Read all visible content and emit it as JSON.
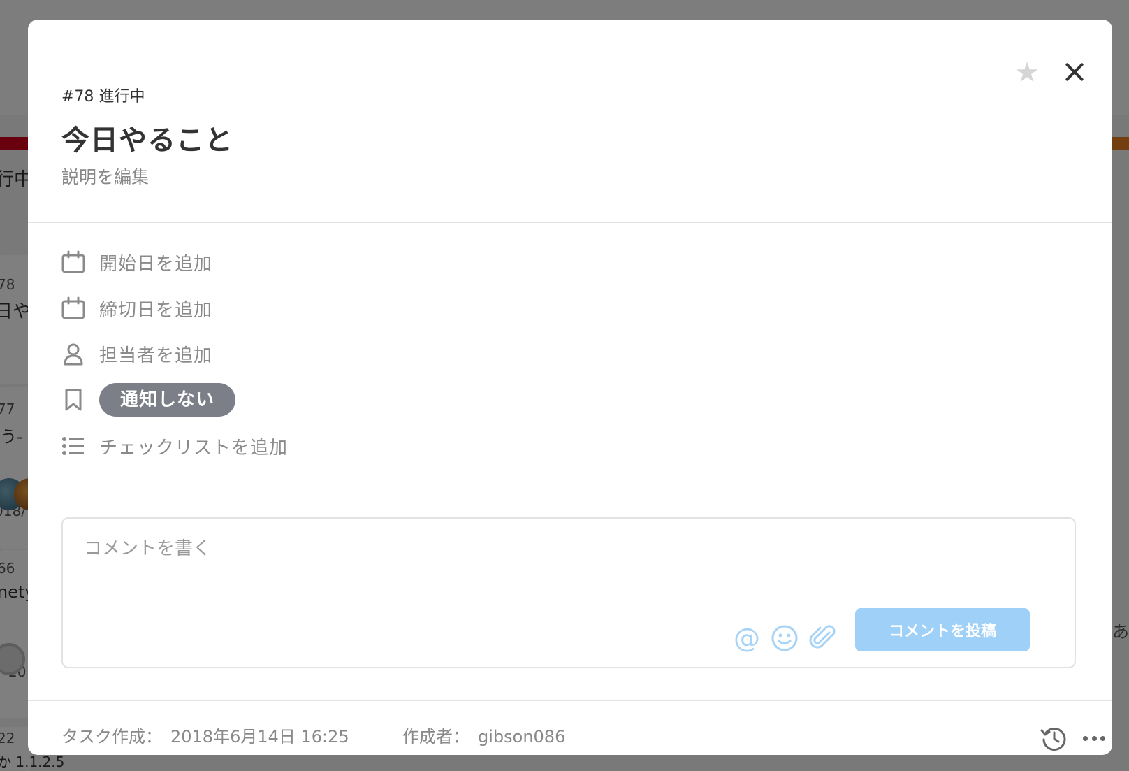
{
  "background": {
    "column_title": "行中",
    "cards": [
      {
        "number": "78",
        "title_fragment": "日や"
      },
      {
        "number": "77",
        "title_fragment": "う-",
        "date_fragment": "018/"
      },
      {
        "number": "66",
        "title_fragment": "nety",
        "date_fragment": "20"
      },
      {
        "number": "22",
        "title_fragment": "か   1.1.2.5"
      }
    ],
    "right_fragment": "あ"
  },
  "modal": {
    "star_glyph": "★",
    "task_number": "#78",
    "task_status": "進行中",
    "title": "今日やること",
    "edit_description": "説明を編集",
    "properties": {
      "start_date": "開始日を追加",
      "due_date": "締切日を追加",
      "assignee": "担当者を追加",
      "notification": "通知しない",
      "checklist": "チェックリストを追加"
    },
    "comment": {
      "placeholder": "コメントを書く",
      "value": "",
      "mention_glyph": "@",
      "post_label": "コメントを投稿"
    },
    "footer": {
      "created_label": "タスク作成：",
      "created_value": "2018年6月14日 16:25",
      "author_label": "作成者：",
      "author_value": "gibson086"
    },
    "colors": {
      "notify_pill": "#7d7f88",
      "post_button": "#9fd0f8",
      "tool_icons": "#a7d3f6"
    }
  }
}
